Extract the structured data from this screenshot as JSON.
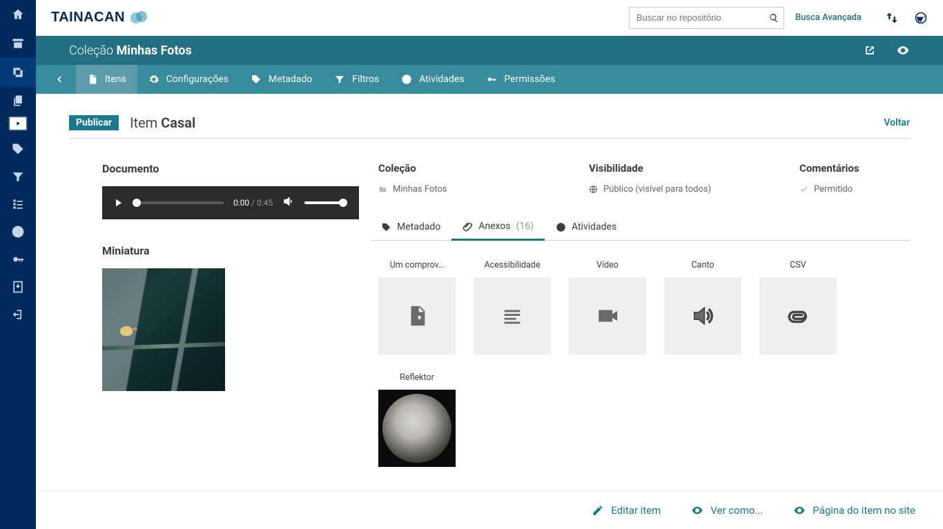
{
  "brand": {
    "name": "TaInacan"
  },
  "topbar": {
    "search_placeholder": "Buscar no repositório",
    "advanced": "Busca Avançada"
  },
  "collection_header": {
    "prefix": "Coleção",
    "name": "Minhas Fotos"
  },
  "collection_tabs": {
    "items": {
      "label": "Itens"
    },
    "settings": {
      "label": "Configurações"
    },
    "metadata": {
      "label": "Metadado"
    },
    "filters": {
      "label": "Filtros"
    },
    "activities": {
      "label": "Atividades"
    },
    "permissions": {
      "label": "Permissões"
    }
  },
  "page": {
    "publish_badge": "Publicar",
    "title_prefix": "Item",
    "title_strong": "Casal",
    "back": "Voltar"
  },
  "left": {
    "document_title": "Documento",
    "audio": {
      "current": "0:00",
      "total": "/ 0:45"
    },
    "thumb_title": "Miniatura"
  },
  "meta": {
    "collection": {
      "label": "Coleção",
      "value": "Minhas Fotos"
    },
    "visibility": {
      "label": "Visibilidade",
      "value": "Público (visível para todos)"
    },
    "comments": {
      "label": "Comentários",
      "value": "Permitido"
    }
  },
  "inner_tabs": {
    "metadata": "Metadado",
    "attachments": "Anexos",
    "attachments_count": "(16)",
    "activities": "Atividades"
  },
  "attachments": [
    {
      "label": "Um comprov…",
      "type": "pdf"
    },
    {
      "label": "Acessibilidade",
      "type": "text"
    },
    {
      "label": "Vídeo",
      "type": "video"
    },
    {
      "label": "Canto",
      "type": "audio"
    },
    {
      "label": "CSV",
      "type": "attachment"
    },
    {
      "label": "Reflektor",
      "type": "image"
    }
  ],
  "footer": {
    "edit": "Editar item",
    "view_as": "Ver como...",
    "site_page": "Página do item no site"
  }
}
